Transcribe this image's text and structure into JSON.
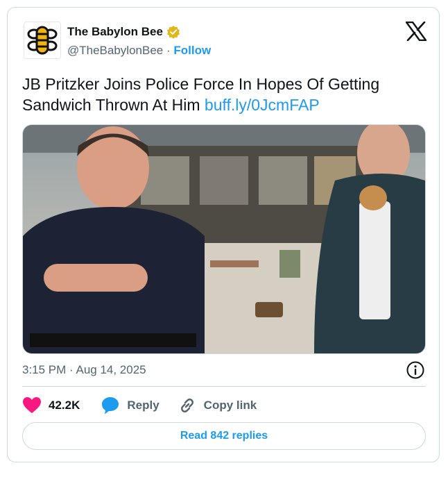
{
  "author": {
    "display_name": "The Babylon Bee",
    "handle": "@TheBabylonBee",
    "separator": "·",
    "follow_label": "Follow",
    "verified_color": "#e2b719"
  },
  "icons": {
    "brand": "x-logo-icon",
    "verified": "verified-badge-icon",
    "info": "info-icon",
    "like": "heart-icon",
    "reply": "speech-bubble-icon",
    "copy": "link-icon"
  },
  "tweet": {
    "text": "JB Pritzker Joins Police Force In Hopes Of Getting Sandwich Thrown At Him",
    "link": "buff.ly/0JcmFAP",
    "timestamp": "3:15 PM · Aug 14, 2025"
  },
  "actions": {
    "like_count": "42.2K",
    "reply_label": "Reply",
    "copy_label": "Copy link"
  },
  "read_replies_label": "Read 842 replies",
  "colors": {
    "accent": "#1d9bf0",
    "like": "#f91880",
    "text": "#0f1419",
    "muted": "#536471",
    "border": "#cfd9de"
  }
}
